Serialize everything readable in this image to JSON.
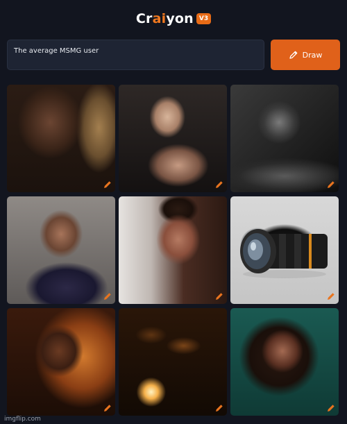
{
  "app": {
    "name_part1": "Cr",
    "name_accent": "ai",
    "name_part2": "yon",
    "version": "V3"
  },
  "prompt": {
    "value": "The average MSMG user"
  },
  "draw_button": {
    "label": "Draw",
    "icon": "pencil-icon"
  },
  "gallery": {
    "images": [
      {
        "id": 0,
        "edit_icon": "pencil-icon"
      },
      {
        "id": 1,
        "edit_icon": "pencil-icon"
      },
      {
        "id": 2,
        "edit_icon": "pencil-icon"
      },
      {
        "id": 3,
        "edit_icon": "pencil-icon"
      },
      {
        "id": 4,
        "edit_icon": "pencil-icon"
      },
      {
        "id": 5,
        "edit_icon": "pencil-icon"
      },
      {
        "id": 6,
        "edit_icon": "pencil-icon"
      },
      {
        "id": 7,
        "edit_icon": "pencil-icon"
      },
      {
        "id": 8,
        "edit_icon": "pencil-icon"
      }
    ]
  },
  "footer": {
    "watermark": "imgflip.com"
  },
  "colors": {
    "background": "#12151f",
    "accent": "#e0611a",
    "input_bg": "#1e2433"
  }
}
